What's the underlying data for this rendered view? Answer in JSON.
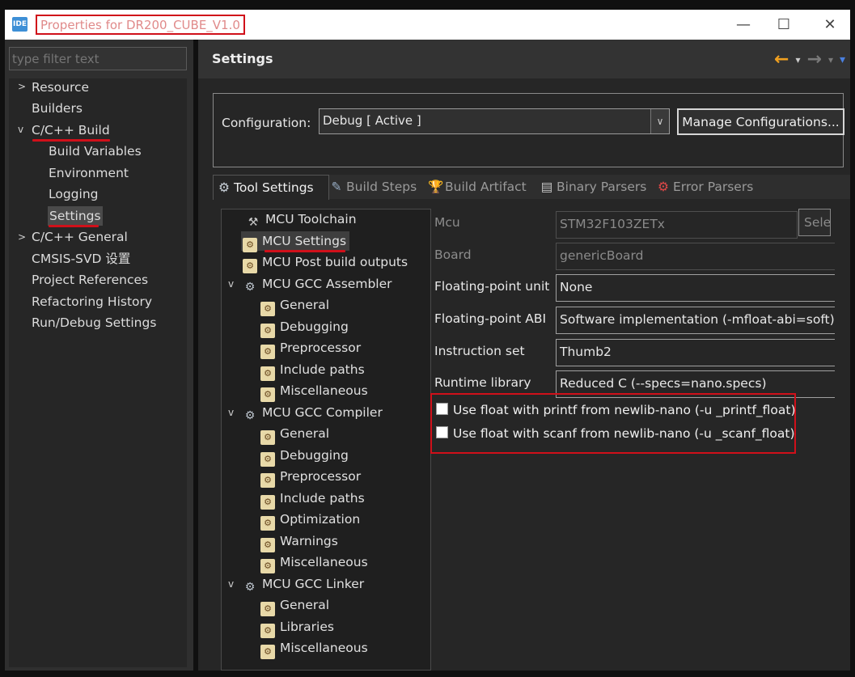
{
  "window": {
    "icon_label": "IDE",
    "title": "Properties for DR200_CUBE_V1.0",
    "minimize": "—",
    "maximize": "☐",
    "close": "✕"
  },
  "left": {
    "filter_placeholder": "type filter text",
    "items": [
      {
        "label": "Resource",
        "chevron": ">"
      },
      {
        "label": "Builders"
      },
      {
        "label": "C/C++ Build",
        "chevron": "v"
      },
      {
        "label": "Build Variables"
      },
      {
        "label": "Environment"
      },
      {
        "label": "Logging"
      },
      {
        "label": "Settings"
      },
      {
        "label": "C/C++ General",
        "chevron": ">"
      },
      {
        "label": "CMSIS-SVD 设置"
      },
      {
        "label": "Project References"
      },
      {
        "label": "Refactoring History"
      },
      {
        "label": "Run/Debug Settings"
      }
    ]
  },
  "header": {
    "title": "Settings",
    "back_icon": "←",
    "forward_icon": "→",
    "menu_icon": "▾"
  },
  "config": {
    "label": "Configuration:",
    "value": "Debug  [ Active ]",
    "manage_button": "Manage Configurations..."
  },
  "tabs": [
    {
      "label": "Tool Settings",
      "icon": "⚙"
    },
    {
      "label": "Build Steps",
      "icon": "✎"
    },
    {
      "label": "Build Artifact",
      "icon": "🏆"
    },
    {
      "label": "Binary Parsers",
      "icon": "▤"
    },
    {
      "label": "Error Parsers",
      "icon": "⚙"
    }
  ],
  "tool_tree": [
    "MCU Toolchain",
    "MCU Settings",
    "MCU Post build outputs",
    "MCU GCC Assembler",
    "General",
    "Debugging",
    "Preprocessor",
    "Include paths",
    "Miscellaneous",
    "MCU GCC Compiler",
    "General",
    "Debugging",
    "Preprocessor",
    "Include paths",
    "Optimization",
    "Warnings",
    "Miscellaneous",
    "MCU GCC Linker",
    "General",
    "Libraries",
    "Miscellaneous"
  ],
  "tree_chevron": "v",
  "fields": {
    "mcu_label": "Mcu",
    "mcu_value": "STM32F103ZETx",
    "select_button": "Sele",
    "board_label": "Board",
    "board_value": "genericBoard",
    "fpu_label": "Floating-point unit",
    "fpu_value": "None",
    "fpabi_label": "Floating-point ABI",
    "fpabi_value": "Software implementation (-mfloat-abi=soft)",
    "iset_label": "Instruction set",
    "iset_value": "Thumb2",
    "runtime_label": "Runtime library",
    "runtime_value": "Reduced C (--specs=nano.specs)"
  },
  "checkboxes": [
    {
      "label": "Use float with printf from newlib-nano (-u _printf_float)",
      "checked": false
    },
    {
      "label": "Use float with scanf from newlib-nano (-u _scanf_float)",
      "checked": false
    }
  ],
  "colors": {
    "highlight_red": "#d0101a",
    "back_arrow": "#f0a020",
    "dropdown_blue": "#4a80e0"
  }
}
